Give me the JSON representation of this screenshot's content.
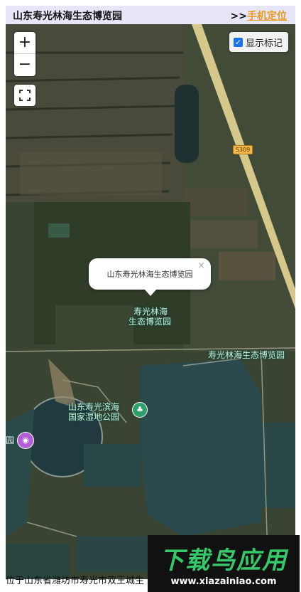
{
  "header": {
    "title": "山东寿光林海生态博览园",
    "locate_prefix": ">>",
    "locate_link": "手机定位"
  },
  "map": {
    "zoom_in": "+",
    "zoom_out": "−",
    "fullscreen_icon": "fullscreen-icon",
    "show_markers_label": "显示标记",
    "show_markers_checked": true,
    "popup_text": "山东寿光林海生态博览园",
    "popup_close": "×",
    "road_shield": "S309",
    "labels": {
      "park_line1": "寿光林海",
      "park_line2": "生态博览园",
      "park_right": "寿光林海生态博览园",
      "wetland_line1": "山东寿光滨海",
      "wetland_line2": "国家湿地公园",
      "left_edge": "园"
    }
  },
  "description": "位于山东省潍坊市寿光市双王城生",
  "watermark": {
    "logo": "下载鸟应用",
    "url": "www.xiazainiao.com"
  }
}
